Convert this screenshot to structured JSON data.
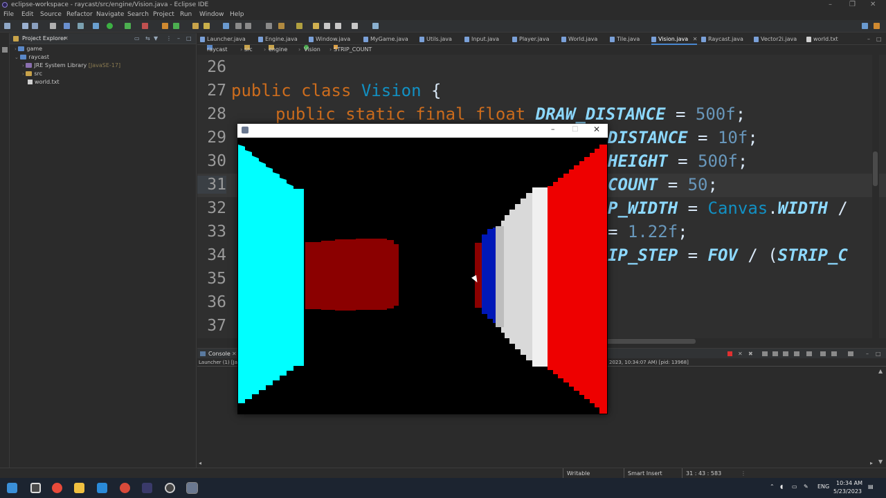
{
  "window": {
    "title": "eclipse-workspace - raycast/src/engine/Vision.java - Eclipse IDE",
    "controls": [
      "–",
      "❐",
      "✕"
    ]
  },
  "menu": [
    "File",
    "Edit",
    "Source",
    "Refactor",
    "Navigate",
    "Search",
    "Project",
    "Run",
    "Window",
    "Help"
  ],
  "explorer": {
    "title": "Project Explorer",
    "items": [
      {
        "label": "game",
        "icon": "project-icon"
      },
      {
        "label": "raycast",
        "icon": "project-icon"
      },
      {
        "label": "JRE System Library",
        "suffix": "[JavaSE-17]",
        "icon": "library-icon"
      },
      {
        "label": "src",
        "icon": "folder-icon"
      },
      {
        "label": "world.txt",
        "icon": "file-icon"
      }
    ]
  },
  "tabs": [
    {
      "label": "Launcher.java"
    },
    {
      "label": "Engine.java"
    },
    {
      "label": "Window.java"
    },
    {
      "label": "MyGame.java"
    },
    {
      "label": "Utils.java"
    },
    {
      "label": "Input.java"
    },
    {
      "label": "Player.java"
    },
    {
      "label": "World.java"
    },
    {
      "label": "Tile.java"
    },
    {
      "label": "Vision.java",
      "active": true
    },
    {
      "label": "Raycast.java"
    },
    {
      "label": "Vector2i.java"
    },
    {
      "label": "world.txt"
    }
  ],
  "breadcrumb": [
    "raycast",
    "src",
    "engine",
    "Vision",
    "STRIP_COUNT : int"
  ],
  "editor": {
    "line_numbers": [
      "26",
      "27",
      "28",
      "29",
      "30",
      "31",
      "32",
      "33",
      "34",
      "35",
      "36",
      "37"
    ],
    "line27": {
      "kw": "public class",
      "cls": "Vision",
      "rest": " {"
    },
    "line28": {
      "kw": "public static final float",
      "const": "DRAW_DISTANCE",
      "eq": " = ",
      "num": "500f",
      "end": ";"
    },
    "line29": {
      "const": "DISTANCE",
      "eq": " = ",
      "num": "10f",
      "end": ";"
    },
    "line30": {
      "const": "HEIGHT",
      "eq": " = ",
      "num": "500f",
      "end": ";"
    },
    "line31": {
      "const": "COUNT",
      "eq": " = ",
      "num": "50",
      "end": ";"
    },
    "line32": {
      "const": "P_WIDTH",
      "eq": " = ",
      "cls": "Canvas",
      "dot": ".",
      "const2": "WIDTH",
      "end": " /"
    },
    "line33": {
      "eq": "= ",
      "num": "1.22f",
      "end": ";"
    },
    "line34": {
      "const": "IP_STEP",
      "eq": " = ",
      "const2": "FOV",
      "end": " / (",
      "const3": "STRIP_C"
    }
  },
  "console": {
    "tab": "Console",
    "left_info": "Launcher (1) [Ja",
    "right_info": "2023, 10:34:07 AM) [pid: 13968]"
  },
  "status": {
    "writable": "Writable",
    "insert_mode": "Smart Insert",
    "position": "31 : 43 : 583"
  },
  "taskbar": {
    "lang": "ENG",
    "time": "10:34 AM",
    "date": "5/23/2023"
  },
  "colors": {
    "cyan_wall": "#00ffff",
    "red_wall": "#ee0000",
    "dark_red": "#8b0000",
    "blue": "#0018b8"
  }
}
